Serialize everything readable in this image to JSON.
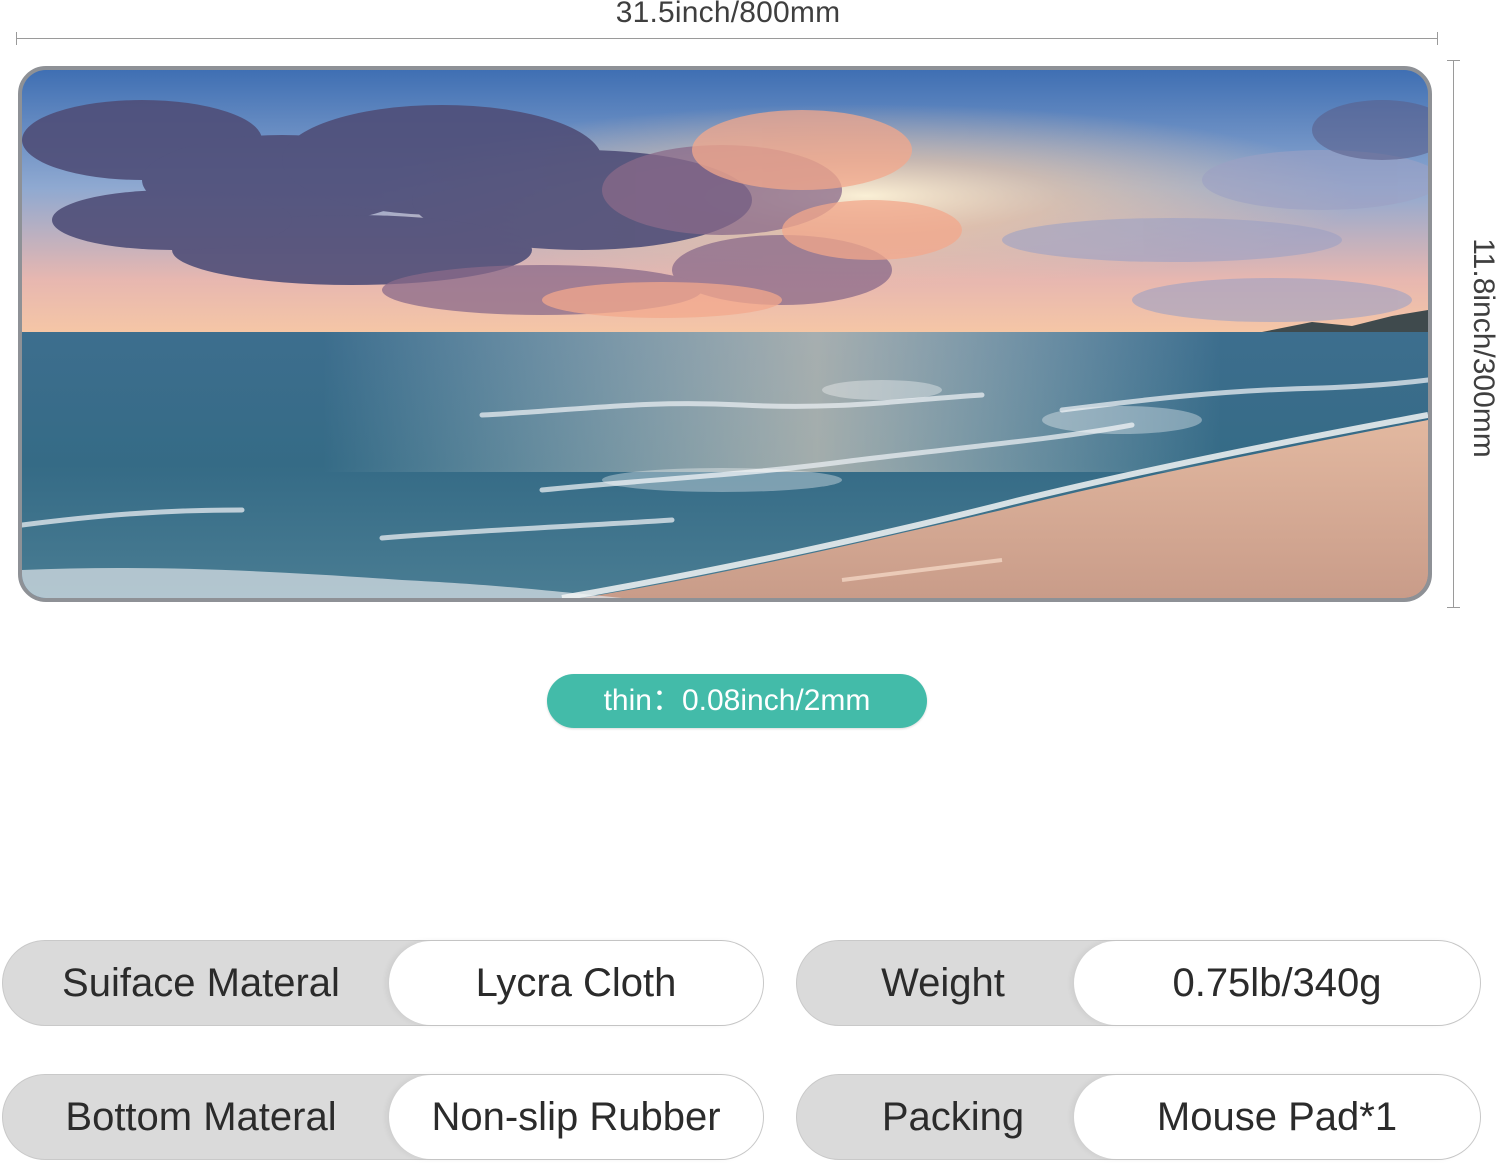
{
  "dimensions": {
    "width_label": "31.5inch/800mm",
    "height_label": "11.8inch/300mm",
    "thickness_label": "thin：0.08inch/2mm"
  },
  "product_image": {
    "subject": "beach sunset seascape mouse pad"
  },
  "colors": {
    "accent_pill": "#43bba9",
    "spec_label_bg": "#dadada",
    "spec_value_bg": "#ffffff"
  },
  "specs": [
    {
      "label": "Suiface Materal",
      "value": "Lycra Cloth"
    },
    {
      "label": "Weight",
      "value": "0.75lb/340g"
    },
    {
      "label": "Bottom Materal",
      "value": "Non-slip Rubber"
    },
    {
      "label": "Packing",
      "value": "Mouse Pad*1"
    }
  ]
}
